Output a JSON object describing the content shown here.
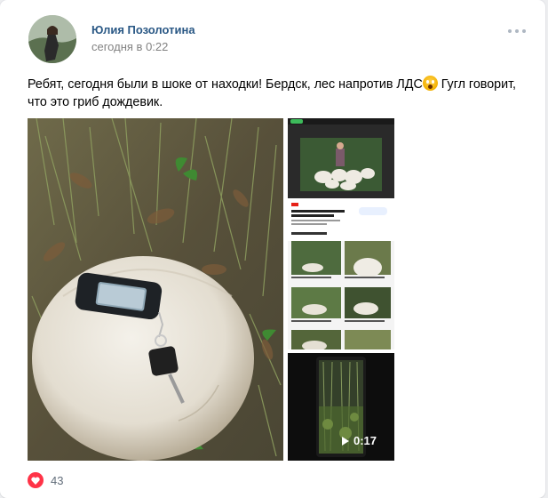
{
  "post": {
    "author": "Юлия Позолотина",
    "time": "сегодня в 0:22",
    "text_before_emoji": "Ребят, сегодня были в шоке от находки! Бердск, лес напротив ЛДС",
    "text_after_emoji": " Гугл говорит, что это гриб дождевик.",
    "emoji": "scream-emoji"
  },
  "attachments": {
    "main_photo": "puffball-mushroom-photo",
    "screenshot_photo": "google-search-screenshot",
    "video": {
      "duration": "0:17"
    }
  },
  "footer": {
    "likes": "43"
  },
  "colors": {
    "author_link": "#2a5885",
    "muted": "#828282",
    "like": "#ff3347"
  }
}
